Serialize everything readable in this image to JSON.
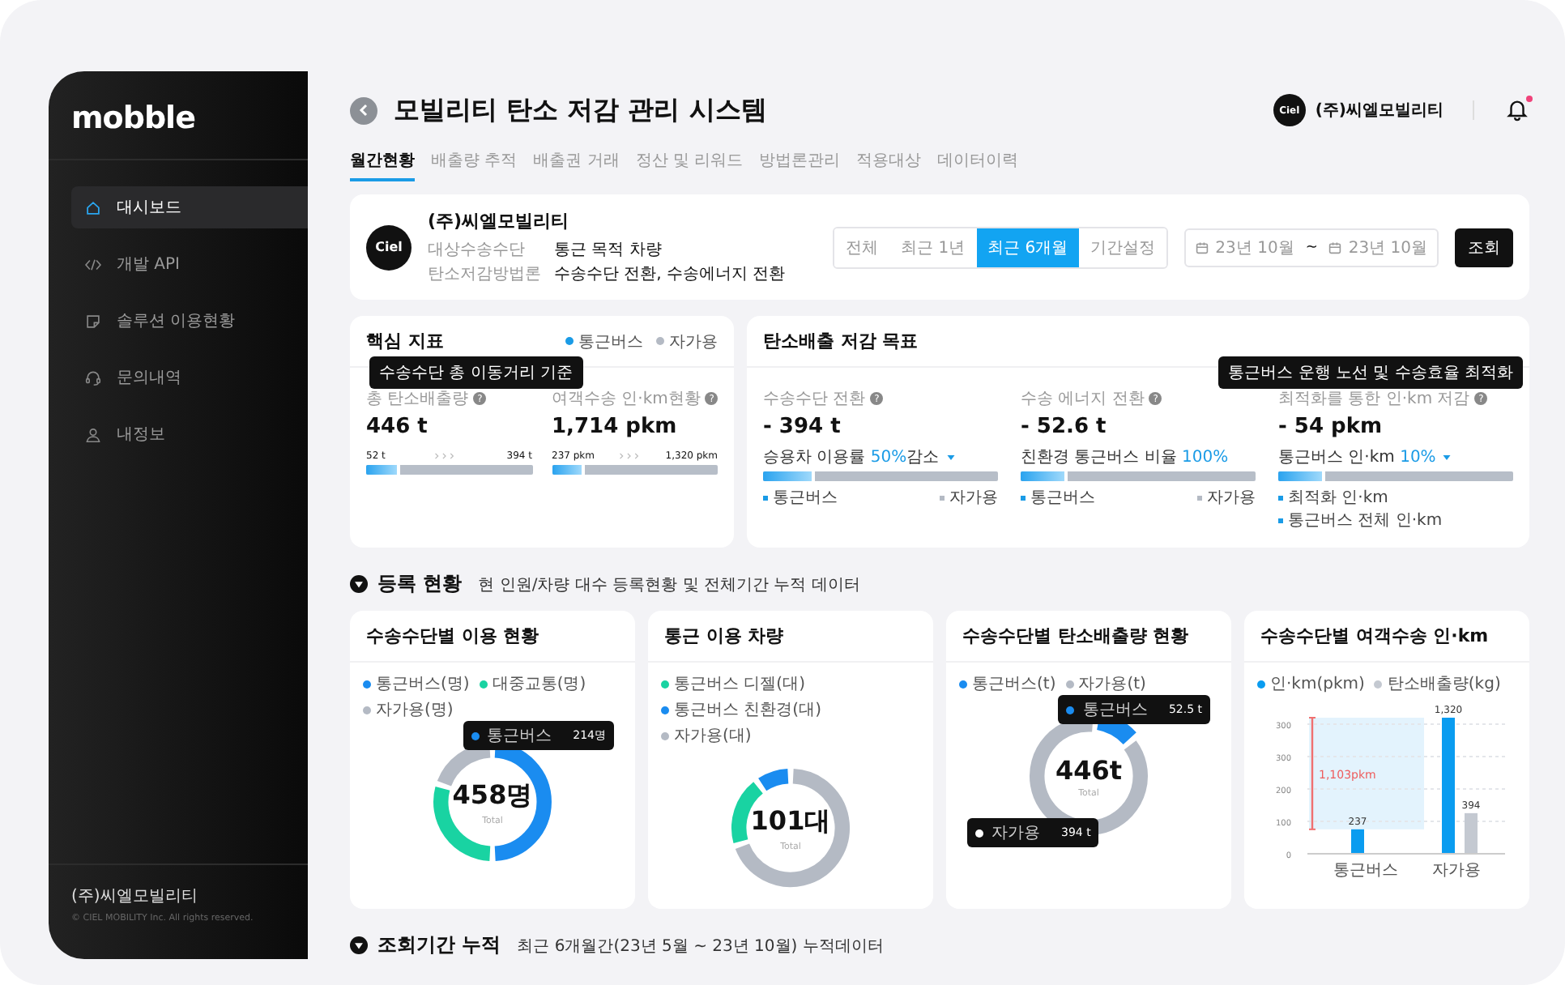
{
  "sidebar": {
    "logo": "mobble",
    "items": [
      {
        "label": "대시보드",
        "selected": true
      },
      {
        "label": "개발 API",
        "selected": false
      },
      {
        "label": "솔루션 이용현황",
        "selected": false
      },
      {
        "label": "문의내역",
        "selected": false
      },
      {
        "label": "내정보",
        "selected": false
      }
    ],
    "company": "(주)씨엘모빌리티",
    "copyright": "© CIEL MOBILITY Inc. All rights reserved."
  },
  "header": {
    "title": "모빌리티 탄소 저감 관리 시스템",
    "account": {
      "logo": "Ciel",
      "name": "(주)씨엘모빌리티"
    },
    "notification": {
      "unread": true
    }
  },
  "tabs": [
    {
      "label": "월간현황",
      "selected": true
    },
    {
      "label": "배출량 추적",
      "selected": false
    },
    {
      "label": "배출권 거래",
      "selected": false
    },
    {
      "label": "정산 및 리워드",
      "selected": false
    },
    {
      "label": "방법론관리",
      "selected": false
    },
    {
      "label": "적용대상",
      "selected": false
    },
    {
      "label": "데이터이력",
      "selected": false
    }
  ],
  "company_card": {
    "logo": "Ciel",
    "name": "(주)씨엘모빌리티",
    "fields": [
      {
        "label": "대상수송수단",
        "value": "통근 목적 차량"
      },
      {
        "label": "탄소저감방법론",
        "value": "수송수단 전환, 수송에너지 전환"
      }
    ]
  },
  "period_filter": {
    "options": [
      {
        "label": "전체",
        "selected": false
      },
      {
        "label": "최근 1년",
        "selected": false
      },
      {
        "label": "최근 6개월",
        "selected": true
      },
      {
        "label": "기간설정",
        "selected": false
      }
    ],
    "date_from": "23년 10월",
    "separator": "~",
    "date_to": "23년 10월",
    "search_button": "조회"
  },
  "key_metrics": {
    "title": "핵심 지표",
    "legend": [
      {
        "label": "통근버스",
        "color": "#1a9be6"
      },
      {
        "label": "자가용",
        "color": "#b4bac4"
      }
    ],
    "metrics": [
      {
        "label": "총 탄소배출량",
        "help": "?",
        "tooltip": "수송수단 총 이동거리 기준",
        "value": "446 t",
        "min": "52 t",
        "max": "394 t",
        "level": 0.2
      },
      {
        "label": "여객수송 인·km현황",
        "help": "?",
        "value": "1,714 pkm",
        "min": "237 pkm",
        "max": "1,320 pkm",
        "level": 0.2
      }
    ]
  },
  "reduction_goals": {
    "title": "탄소배출 저감 목표",
    "metrics": [
      {
        "label": "수송수단 전환",
        "help": "?",
        "value": "- 394 t",
        "note": "승용차 이용률",
        "highlight": "50%",
        "suffix": "감소",
        "caret": true,
        "level": 0.22,
        "legend": [
          {
            "label": "통근버스",
            "color": "#1a9be6"
          },
          {
            "label": "자가용",
            "color": "#b4bac4"
          }
        ]
      },
      {
        "label": "수송 에너지 전환",
        "help": "?",
        "value": "- 52.6 t",
        "note": "친환경 통근버스 비율",
        "highlight": "100%",
        "caret": false,
        "level": 0.2,
        "legend": [
          {
            "label": "통근버스",
            "color": "#1a9be6"
          },
          {
            "label": "자가용",
            "color": "#b4bac4"
          }
        ]
      },
      {
        "label": "최적화를 통한 인·km 저감",
        "help": "?",
        "tooltip": "통근버스 운행 노선 및 수송효율 최적화",
        "value": "- 54 pkm",
        "note": "통근버스 인·km",
        "highlight": "10%",
        "caret": true,
        "level": 0.2,
        "legend": [
          {
            "label": "최적화 인·km",
            "color": "#1a9be6"
          },
          {
            "label": "통근버스 전체 인·km",
            "color": "#1a9be6"
          }
        ]
      }
    ]
  },
  "registration": {
    "title": "등록 현황",
    "subtitle": "현 인원/차량 대수 등록현황 및 전체기간 누적 데이터",
    "cards": [
      {
        "kind": "donut",
        "title": "수송수단별 이용 현황",
        "legend": [
          {
            "label": "통근버스(명)",
            "color": "#1a8cf0"
          },
          {
            "label": "대중교통(명)",
            "color": "#19d3a2"
          },
          {
            "label": "자가용(명)",
            "color": "#b4bac4"
          }
        ],
        "total": "458명",
        "total_label": "Total",
        "tooltips": [
          {
            "label": "통근버스",
            "value": "214명",
            "color": "#1a8cf0"
          }
        ]
      },
      {
        "kind": "donut",
        "title": "통근 이용 차량",
        "legend": [
          {
            "label": "통근버스 디젤(대)",
            "color": "#19d3a2"
          },
          {
            "label": "통근버스 친환경(대)",
            "color": "#1a8cf0"
          },
          {
            "label": "자가용(대)",
            "color": "#b4bac4"
          }
        ],
        "total": "101대",
        "total_label": "Total"
      },
      {
        "kind": "donut",
        "title": "수송수단별 탄소배출량 현황",
        "legend": [
          {
            "label": "통근버스(t)",
            "color": "#1a8cf0"
          },
          {
            "label": "자가용(t)",
            "color": "#b4bac4"
          }
        ],
        "total": "446t",
        "total_label": "Total",
        "tooltips": [
          {
            "label": "통근버스",
            "value": "52.5 t",
            "color": "#1a8cf0"
          },
          {
            "label": "자가용",
            "value": "394 t",
            "color": "#ffffff"
          }
        ]
      },
      {
        "kind": "bar",
        "title": "수송수단별 여객수송 인·km",
        "y_axis_labels": [
          "300",
          "300",
          "200",
          "100",
          "0"
        ],
        "chart_data": {
          "type": "bar",
          "categories": [
            "통근버스",
            "자가용"
          ],
          "series": [
            {
              "name": "인·km(pkm)",
              "color": "#0a9cf0",
              "values": [
                237,
                1320
              ],
              "value_labels": [
                "237",
                "1,320"
              ]
            },
            {
              "name": "탄소배출량(kg)",
              "color": "#c4c9d1",
              "values": [
                null,
                394
              ],
              "value_labels": [
                null,
                "394"
              ]
            }
          ],
          "data_labels": "value_labels",
          "annotations": [
            {
              "text": "1,103pkm"
            }
          ]
        }
      }
    ]
  },
  "accumulated": {
    "title": "조회기간 누적",
    "subtitle": "최근 6개월간(23년 5월 ~ 23년 10월) 누적데이터"
  }
}
